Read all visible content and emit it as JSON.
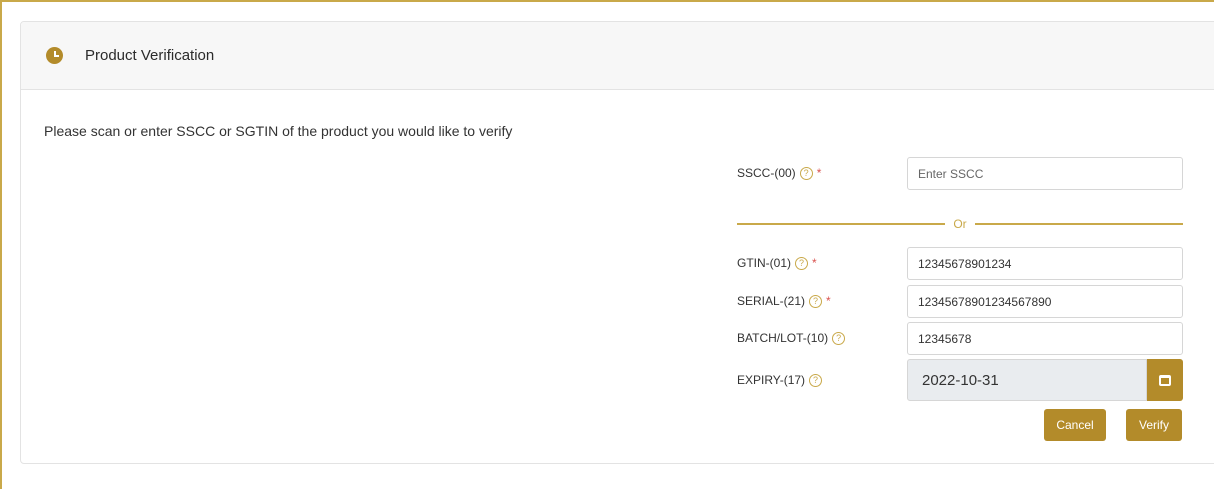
{
  "header": {
    "title": "Product Verification",
    "icon": "clock-icon"
  },
  "intro_text": "Please scan or enter SSCC or SGTIN of the product you would like to verify",
  "help_glyph": "?",
  "required_marker": "*",
  "fields": {
    "sscc": {
      "label": "SSCC-(00)",
      "placeholder": "Enter SSCC",
      "value": ""
    },
    "divider_text": "Or",
    "gtin": {
      "label": "GTIN-(01)",
      "value": "12345678901234"
    },
    "serial": {
      "label": "SERIAL-(21)",
      "value": "12345678901234567890"
    },
    "batch": {
      "label": "BATCH/LOT-(10)",
      "value": "12345678"
    },
    "expiry": {
      "label": "EXPIRY-(17)",
      "value": "2022-10-31"
    }
  },
  "buttons": {
    "cancel": "Cancel",
    "verify": "Verify"
  },
  "colors": {
    "accent": "#b38b2a",
    "required": "#d9534f"
  }
}
